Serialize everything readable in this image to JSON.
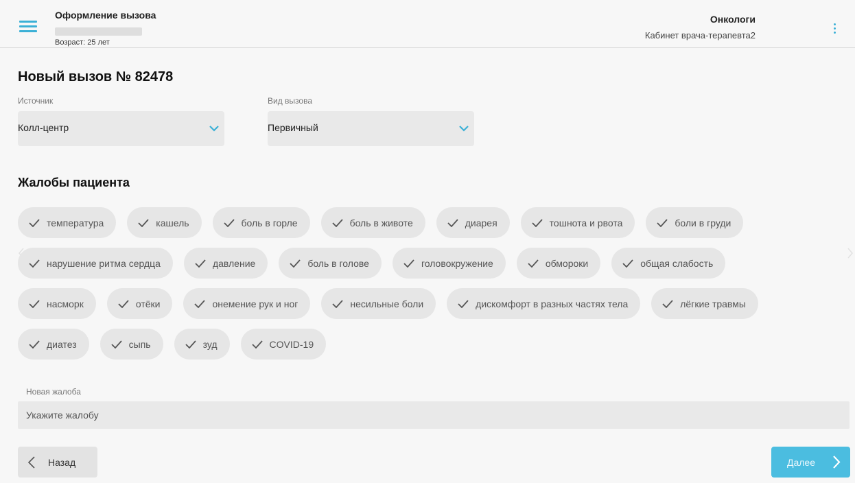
{
  "header": {
    "title": "Оформление вызова",
    "age": "Возраст: 25 лет",
    "department": "Онкологи",
    "cabinet": "Кабинет врача-терапевта2"
  },
  "page": {
    "title": "Новый вызов № 82478"
  },
  "source": {
    "label": "Источник",
    "value": "Колл-центр"
  },
  "call_type": {
    "label": "Вид вызова",
    "value": "Первичный"
  },
  "complaints": {
    "title": "Жалобы пациента",
    "rows": [
      [
        "температура",
        "кашель",
        "боль в горле",
        "боль в животе",
        "диарея",
        "тошнота и рвота",
        "боли в груди"
      ],
      [
        "нарушение ритма сердца",
        "давление",
        "боль в голове",
        "головокружение",
        "обмороки",
        "общая слабость"
      ],
      [
        "насморк",
        "отёки",
        "онемение рук и ног",
        "несильные боли",
        "дискомфорт в разных частях тела",
        "лёгкие травмы"
      ],
      [
        "диатез",
        "сыпь",
        "зуд",
        "COVID-19"
      ]
    ]
  },
  "new_complaint": {
    "label": "Новая жалоба",
    "placeholder": "Укажите жалобу"
  },
  "buttons": {
    "back": "Назад",
    "next": "Далее"
  },
  "colors": {
    "accent": "#3bb0d6",
    "next_button": "#4bbde0",
    "chip_bg": "#e6e6e6"
  }
}
